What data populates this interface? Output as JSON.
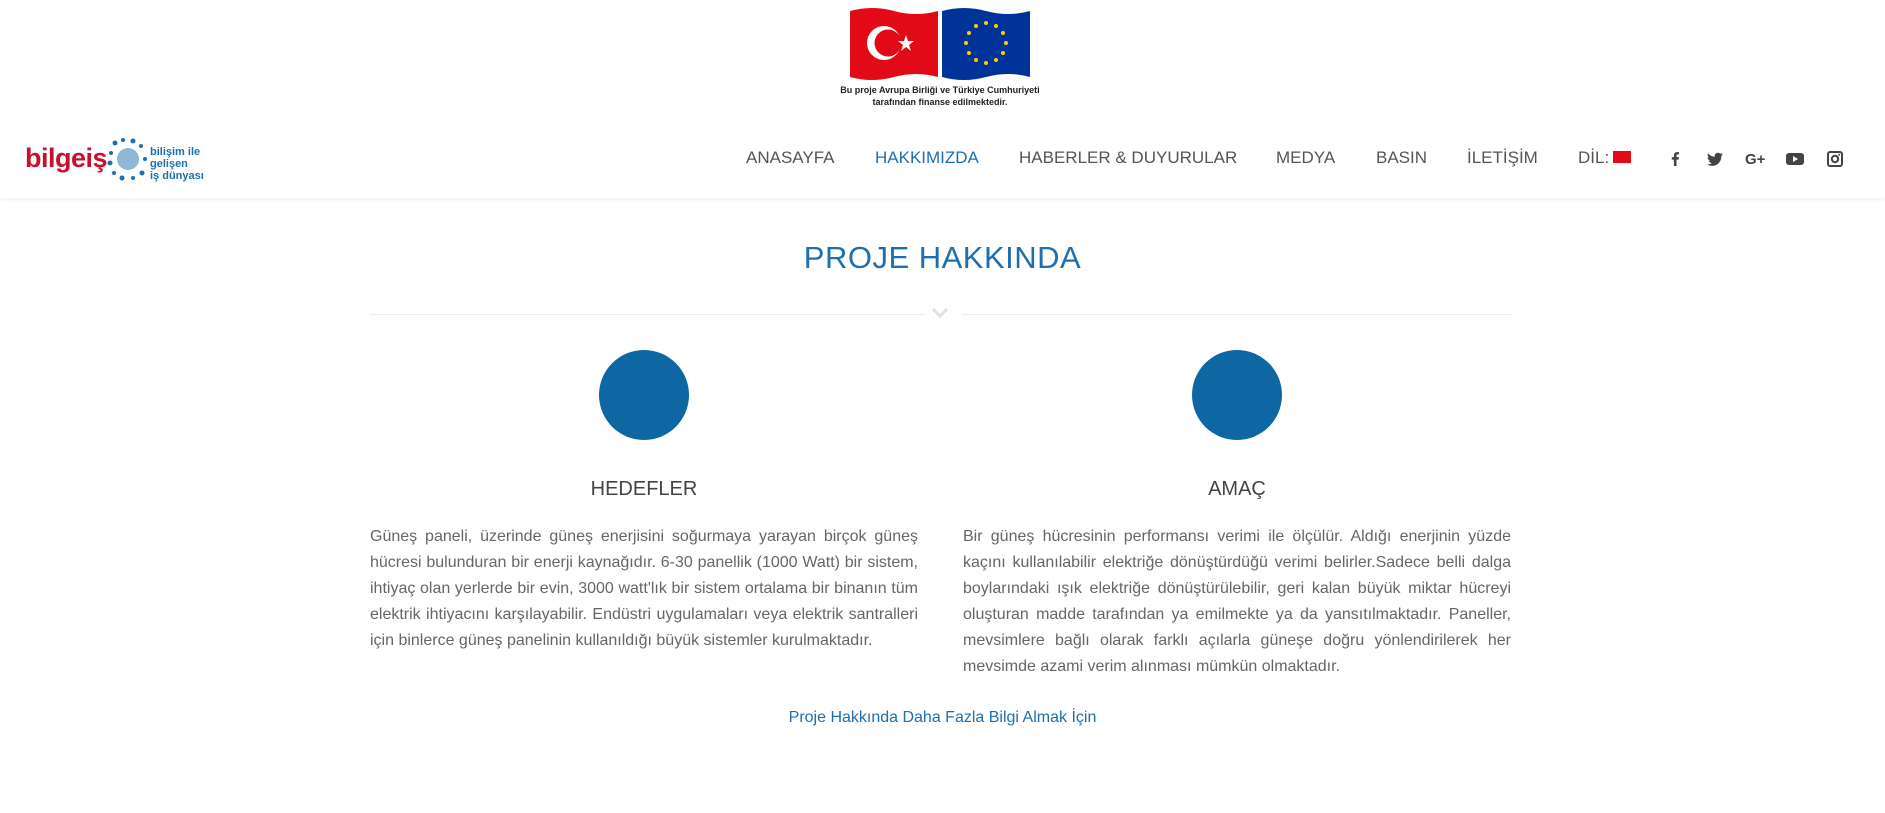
{
  "banner": {
    "caption_line1": "Bu proje Avrupa Birliği ve Türkiye Cumhuriyeti",
    "caption_line2": "tarafından finanse edilmektedir."
  },
  "logo": {
    "word": "bilgeiş",
    "tagline_line1": "bilişim ile gelişen",
    "tagline_line2": "iş dünyası"
  },
  "nav": {
    "items": [
      {
        "label": "ANASAYFA",
        "active": false
      },
      {
        "label": "HAKKIMIZDA",
        "active": true
      },
      {
        "label": "HABERLER & DUYURULAR",
        "active": false
      },
      {
        "label": "MEDYA",
        "active": false
      },
      {
        "label": "BASIN",
        "active": false
      },
      {
        "label": "İLETİŞİM",
        "active": false
      }
    ],
    "language_label": "DİL:",
    "social_icons": [
      "facebook-icon",
      "twitter-icon",
      "google-plus-icon",
      "youtube-icon",
      "instagram-icon"
    ]
  },
  "section": {
    "title": "PROJE HAKKINDA",
    "columns": [
      {
        "title": "HEDEFLER",
        "text": "Güneş paneli, üzerinde güneş enerjisini soğurmaya yarayan birçok güneş hücresi bulunduran bir enerji kaynağıdır. 6-30 panellik (1000 Watt) bir sistem, ihtiyaç olan yerlerde bir evin, 3000 watt'lık bir sistem ortalama bir binanın tüm elektrik ihtiyacını karşılayabilir. Endüstri uygulamaları veya elektrik santralleri için binlerce güneş panelinin kullanıldığı büyük sistemler kurulmaktadır."
      },
      {
        "title": "AMAÇ",
        "text": "Bir güneş hücresinin performansı verimi ile ölçülür. Aldığı enerjinin yüzde kaçını kullanılabilir elektriğe dönüştürdüğü verimi belirler.Sadece belli dalga boylarındaki ışık elektriğe dönüştürülebilir, geri kalan büyük miktar hücreyi oluşturan madde tarafından ya emilmekte ya da yansıtılmaktadır. Paneller, mevsimlere bağlı olarak farklı açılarla güneşe doğru yönlendirilerek her mevsimde azami verim alınması mümkün olmaktadır."
      }
    ],
    "more_link": "Proje Hakkında Daha Fazla Bilgi Almak İçin"
  },
  "colors": {
    "accent": "#1d6fb1",
    "circle": "#0e66a3",
    "logo_red": "#c8102e",
    "tr_flag_red": "#e30a17",
    "eu_blue": "#003399",
    "eu_star": "#ffcc00"
  }
}
